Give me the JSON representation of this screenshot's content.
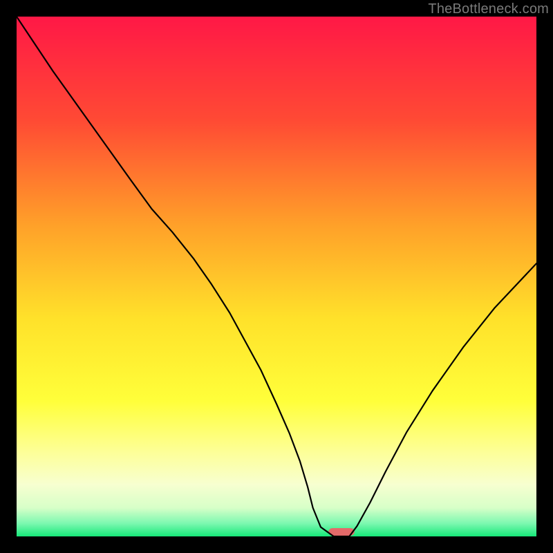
{
  "watermark": "TheBottleneck.com",
  "chart_data": {
    "type": "line",
    "title": "",
    "xlabel": "",
    "ylabel": "",
    "xlim": [
      0,
      100
    ],
    "ylim": [
      0,
      100
    ],
    "gradient_stops": [
      {
        "offset": 0.0,
        "color": "#ff1846"
      },
      {
        "offset": 0.2,
        "color": "#ff4a34"
      },
      {
        "offset": 0.4,
        "color": "#ffa029"
      },
      {
        "offset": 0.58,
        "color": "#ffe12a"
      },
      {
        "offset": 0.74,
        "color": "#ffff3a"
      },
      {
        "offset": 0.84,
        "color": "#fdff9a"
      },
      {
        "offset": 0.9,
        "color": "#f7ffd0"
      },
      {
        "offset": 0.945,
        "color": "#d7ffc8"
      },
      {
        "offset": 0.975,
        "color": "#7cf8b0"
      },
      {
        "offset": 1.0,
        "color": "#16e879"
      }
    ],
    "series": [
      {
        "name": "bottleneck-curve",
        "x": [
          0.0,
          3.0,
          7.0,
          12.0,
          17.0,
          22.0,
          26.0,
          30.0,
          34.0,
          37.5,
          41.0,
          44.0,
          47.0,
          50.0,
          52.5,
          54.5,
          56.0,
          57.0,
          58.5,
          61.0,
          64.0,
          65.5,
          68.0,
          71.0,
          75.0,
          80.0,
          86.0,
          92.0,
          100.0
        ],
        "y": [
          100.0,
          95.5,
          89.5,
          82.5,
          75.5,
          68.5,
          63.0,
          58.5,
          53.5,
          48.5,
          43.0,
          37.5,
          32.0,
          25.5,
          19.8,
          14.5,
          9.5,
          5.5,
          1.8,
          0.0,
          0.0,
          2.0,
          6.5,
          12.5,
          20.0,
          28.0,
          36.5,
          44.0,
          52.5
        ]
      }
    ],
    "marker": {
      "name": "target-marker",
      "x_center": 62.5,
      "width": 5.0,
      "color": "#e46a6a"
    }
  }
}
